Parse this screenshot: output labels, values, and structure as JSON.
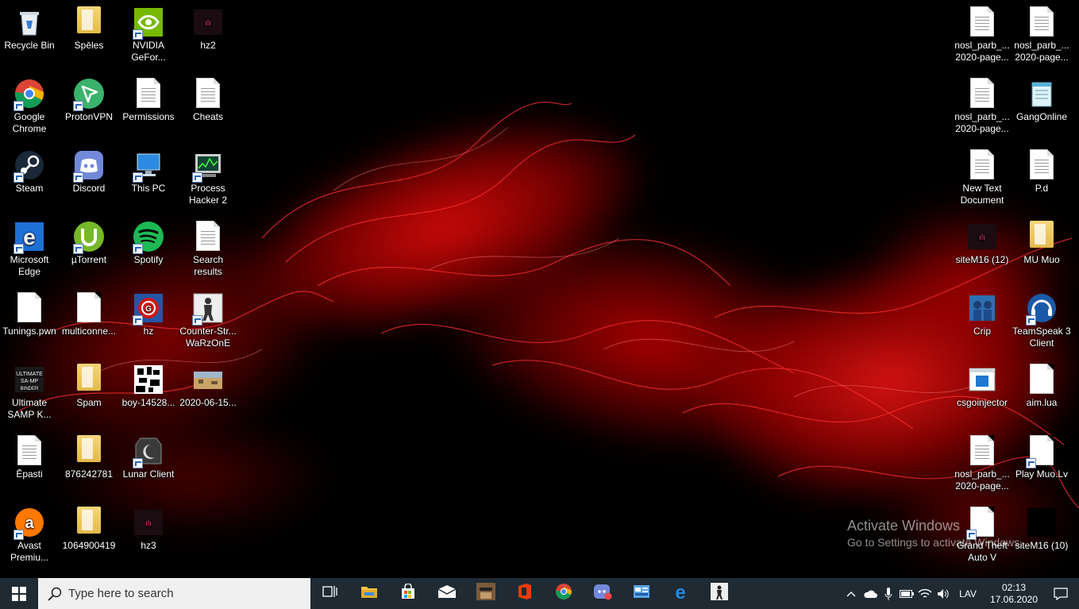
{
  "desktop": {
    "left_icons": [
      {
        "label": "Recycle Bin",
        "icon": "recycle-bin-icon",
        "kind": "bin",
        "shortcut": false
      },
      {
        "label": "Spēles",
        "icon": "folder-icon",
        "kind": "folder",
        "shortcut": false
      },
      {
        "label": "NVIDIA GeFor...",
        "icon": "nvidia-icon",
        "kind": "nvidia",
        "shortcut": true
      },
      {
        "label": "hz2",
        "icon": "app-icon",
        "kind": "dark",
        "shortcut": false
      },
      {
        "label": "Google Chrome",
        "icon": "chrome-icon",
        "kind": "chrome",
        "shortcut": true
      },
      {
        "label": "ProtonVPN",
        "icon": "protonvpn-icon",
        "kind": "proton",
        "shortcut": true
      },
      {
        "label": "Permissions",
        "icon": "text-document-icon",
        "kind": "doc",
        "shortcut": false
      },
      {
        "label": "Cheats",
        "icon": "text-document-icon",
        "kind": "doc",
        "shortcut": false
      },
      {
        "label": "Steam",
        "icon": "steam-icon",
        "kind": "steam",
        "shortcut": true
      },
      {
        "label": "Discord",
        "icon": "discord-icon",
        "kind": "discord",
        "shortcut": true
      },
      {
        "label": "This PC",
        "icon": "this-pc-icon",
        "kind": "pc",
        "shortcut": true
      },
      {
        "label": "Process Hacker 2",
        "icon": "process-hacker-icon",
        "kind": "ph",
        "shortcut": true
      },
      {
        "label": "Microsoft Edge",
        "icon": "edge-icon",
        "kind": "edge",
        "shortcut": true
      },
      {
        "label": "µTorrent",
        "icon": "utorrent-icon",
        "kind": "utorrent",
        "shortcut": true
      },
      {
        "label": "Spotify",
        "icon": "spotify-icon",
        "kind": "spotify",
        "shortcut": true
      },
      {
        "label": "Search results",
        "icon": "text-document-icon",
        "kind": "doc",
        "shortcut": false
      },
      {
        "label": "Tunings.pwn",
        "icon": "file-icon",
        "kind": "blank",
        "shortcut": false
      },
      {
        "label": "multiconne...",
        "icon": "file-icon",
        "kind": "blank",
        "shortcut": false
      },
      {
        "label": "hz",
        "icon": "app-icon",
        "kind": "hz",
        "shortcut": true
      },
      {
        "label": "Counter-Str... WaRzOnE",
        "icon": "counter-strike-icon",
        "kind": "cs",
        "shortcut": true
      },
      {
        "label": "Ultimate SAMP K...",
        "icon": "samp-icon",
        "kind": "samp",
        "shortcut": false
      },
      {
        "label": "Spam",
        "icon": "folder-icon",
        "kind": "folder",
        "shortcut": false
      },
      {
        "label": "boy-14528...",
        "icon": "image-icon",
        "kind": "pixel",
        "shortcut": false
      },
      {
        "label": "2020-06-15...",
        "icon": "image-icon",
        "kind": "photo",
        "shortcut": false
      },
      {
        "label": "Ēpasti",
        "icon": "text-document-icon",
        "kind": "doc",
        "shortcut": false
      },
      {
        "label": "876242781",
        "icon": "folder-icon",
        "kind": "folder",
        "shortcut": false
      },
      {
        "label": "Lunar Client",
        "icon": "lunar-client-icon",
        "kind": "lunar",
        "shortcut": true
      },
      {
        "label": "",
        "icon": "",
        "kind": "none",
        "shortcut": false
      },
      {
        "label": "Avast Premiu...",
        "icon": "avast-icon",
        "kind": "avast",
        "shortcut": true
      },
      {
        "label": "1064900419",
        "icon": "folder-icon",
        "kind": "folder",
        "shortcut": false
      },
      {
        "label": "hz3",
        "icon": "app-icon",
        "kind": "dark",
        "shortcut": false
      },
      {
        "label": "",
        "icon": "",
        "kind": "none",
        "shortcut": false
      }
    ],
    "right_icons": [
      {
        "label": "nosl_parb_... 2020-page...",
        "icon": "document-page-icon",
        "kind": "doc",
        "shortcut": false
      },
      {
        "label": "nosl_parb_... 2020-page...",
        "icon": "document-page-icon",
        "kind": "doc",
        "shortcut": false
      },
      {
        "label": "nosl_parb_... 2020-page...",
        "icon": "document-page-icon",
        "kind": "doc",
        "shortcut": false
      },
      {
        "label": "GangOnline",
        "icon": "notepad-icon",
        "kind": "notepad",
        "shortcut": false
      },
      {
        "label": "New Text Document",
        "icon": "text-document-icon",
        "kind": "doc",
        "shortcut": false
      },
      {
        "label": "P.d",
        "icon": "text-document-icon",
        "kind": "doc",
        "shortcut": false
      },
      {
        "label": "siteM16 (12)",
        "icon": "image-icon",
        "kind": "dark",
        "shortcut": false
      },
      {
        "label": "MU Muo",
        "icon": "folder-icon",
        "kind": "folder",
        "shortcut": false
      },
      {
        "label": "Crip",
        "icon": "image-icon",
        "kind": "crip",
        "shortcut": false
      },
      {
        "label": "TeamSpeak 3 Client",
        "icon": "teamspeak-icon",
        "kind": "ts",
        "shortcut": true
      },
      {
        "label": "csgoinjector",
        "icon": "app-window-icon",
        "kind": "window",
        "shortcut": false
      },
      {
        "label": "aim.lua",
        "icon": "file-icon",
        "kind": "blank",
        "shortcut": false
      },
      {
        "label": "nosl_parb_... 2020-page...",
        "icon": "document-page-icon",
        "kind": "doc",
        "shortcut": false
      },
      {
        "label": "Play Muo.Lv",
        "icon": "file-icon",
        "kind": "blank",
        "shortcut": true
      },
      {
        "label": "Grand Theft Auto V",
        "icon": "file-icon",
        "kind": "blank",
        "shortcut": true
      },
      {
        "label": "siteM16 (10)",
        "icon": "image-icon",
        "kind": "black",
        "shortcut": false
      }
    ]
  },
  "watermark": {
    "title": "Activate Windows",
    "subtitle": "Go to Settings to activate Windows."
  },
  "taskbar": {
    "search_placeholder": "Type here to search",
    "pinned": [
      {
        "name": "task-view-icon"
      },
      {
        "name": "file-explorer-icon"
      },
      {
        "name": "microsoft-store-icon"
      },
      {
        "name": "mail-icon"
      },
      {
        "name": "game-avatar-icon"
      },
      {
        "name": "office-icon"
      },
      {
        "name": "chrome-icon"
      },
      {
        "name": "discord-notification-icon"
      },
      {
        "name": "control-panel-icon"
      },
      {
        "name": "edge-icon"
      },
      {
        "name": "counter-strike-icon"
      }
    ],
    "tray": {
      "language": "LAV",
      "time": "02:13",
      "date": "17.06.2020"
    }
  },
  "colors": {
    "taskbar_bg": "#1f2a33",
    "search_bg": "#f0f0f0",
    "wallpaper_accent": "#d40000"
  }
}
